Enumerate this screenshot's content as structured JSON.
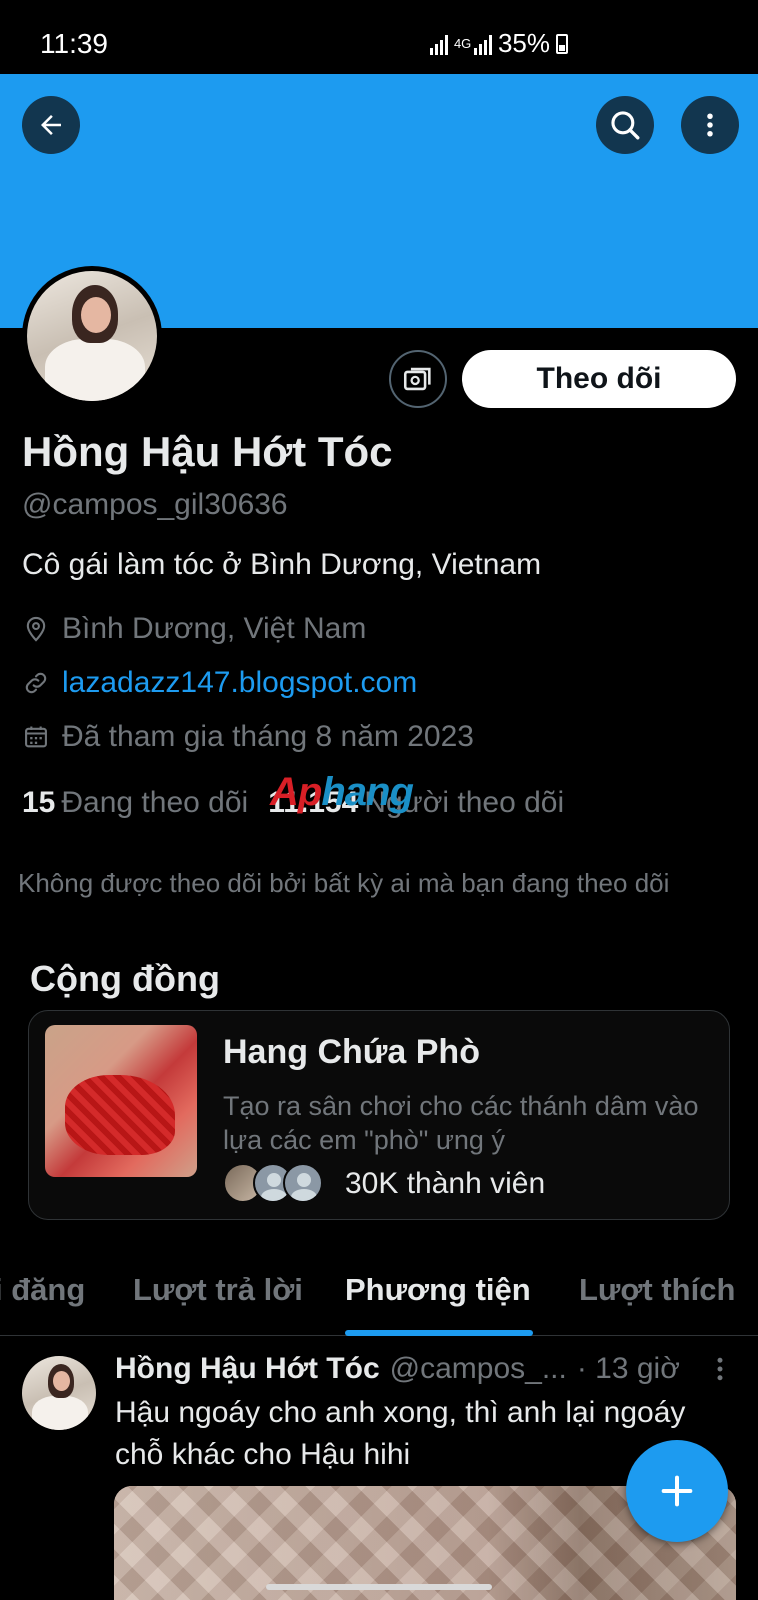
{
  "status_bar": {
    "time": "11:39",
    "network": "4G",
    "battery": "35%"
  },
  "header": {
    "banner_color": "#1d9bf0",
    "back_icon": "arrow-left-icon",
    "search_icon": "search-icon",
    "more_icon": "more-vertical-icon"
  },
  "profile": {
    "follow_label": "Theo dõi",
    "display_name": "Hồng Hậu Hớt Tóc",
    "handle": "@campos_gil30636",
    "bio": "Cô gái làm tóc ở Bình Dương, Vietnam",
    "location": "Bình Dương, Việt Nam",
    "website": "lazadazz147.blogspot.com",
    "joined": "Đã tham gia tháng 8 năm 2023",
    "following_count": "15",
    "following_label": "Đang theo dõi",
    "followers_count": "11.154",
    "followers_label": "Người theo dõi",
    "not_followed_note": "Không được theo dõi bởi bất kỳ ai mà bạn đang theo dõi"
  },
  "watermark": {
    "part1": "Ap",
    "part2": "hang"
  },
  "community": {
    "section_title": "Cộng đồng",
    "name": "Hang Chứa Phò",
    "description": "Tạo ra sân chơi cho các thánh dâm vào lựa các em \"phò\" ưng ý",
    "members": "30K thành viên"
  },
  "tabs": [
    {
      "label": "i đăng",
      "active": false
    },
    {
      "label": "Lượt trả lời",
      "active": false
    },
    {
      "label": "Phương tiện",
      "active": true
    },
    {
      "label": "Lượt thích",
      "active": false
    }
  ],
  "post": {
    "author": "Hồng Hậu Hớt Tóc",
    "handle": "@campos_...",
    "time": "· 13 giờ",
    "text": "Hậu ngoáy cho anh xong, thì anh lại ngoáy chỗ khác cho Hậu hihi"
  },
  "colors": {
    "accent": "#1d9bf0",
    "background": "#000000",
    "text_primary": "#e7e9ea",
    "text_secondary": "#71767b"
  }
}
